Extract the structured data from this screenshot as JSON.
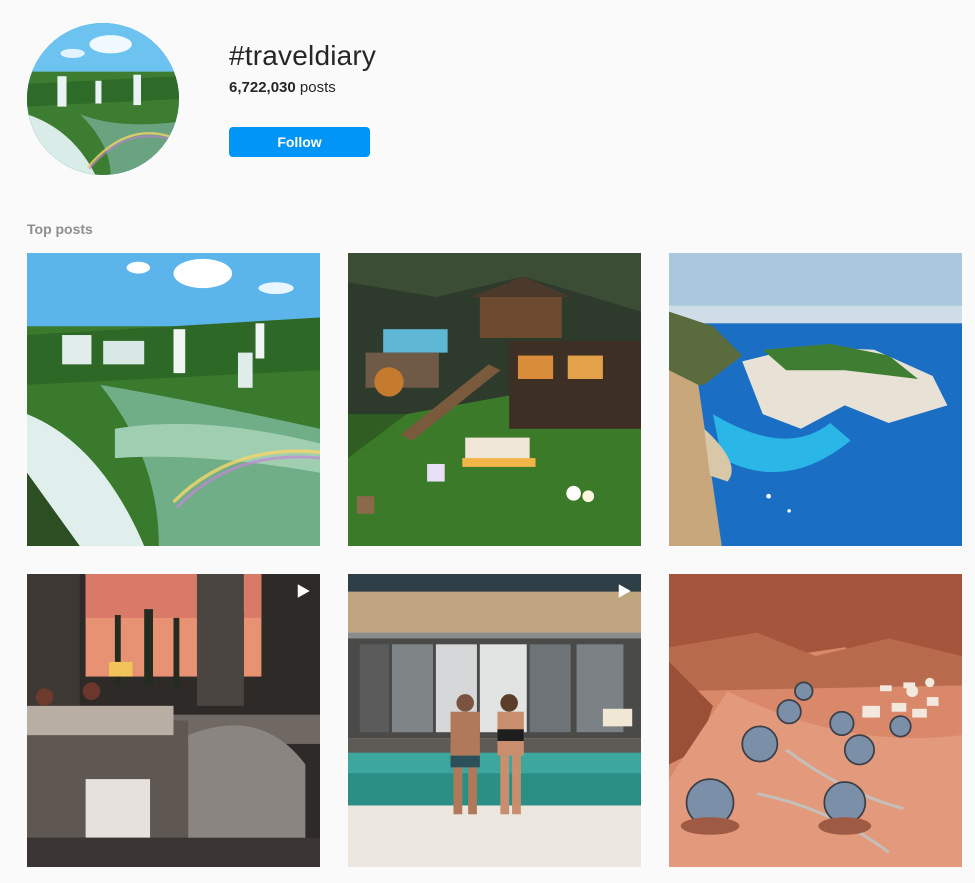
{
  "header": {
    "hashtag": "#traveldiary",
    "post_count": "6,722,030",
    "post_count_label": "posts",
    "follow_label": "Follow",
    "follow_color": "#0095f6"
  },
  "sections": {
    "top_posts_label": "Top posts"
  },
  "posts": [
    {
      "subject": "waterfalls with rainbow",
      "video": false
    },
    {
      "subject": "mountain chalet with glass pool at dusk",
      "video": false
    },
    {
      "subject": "cliffside cove with turquoise sea",
      "video": false
    },
    {
      "subject": "terrace dinner table at sunset",
      "video": true
    },
    {
      "subject": "couple sitting at pool edge",
      "video": true
    },
    {
      "subject": "desert dome camp among red rocks",
      "video": false
    }
  ]
}
